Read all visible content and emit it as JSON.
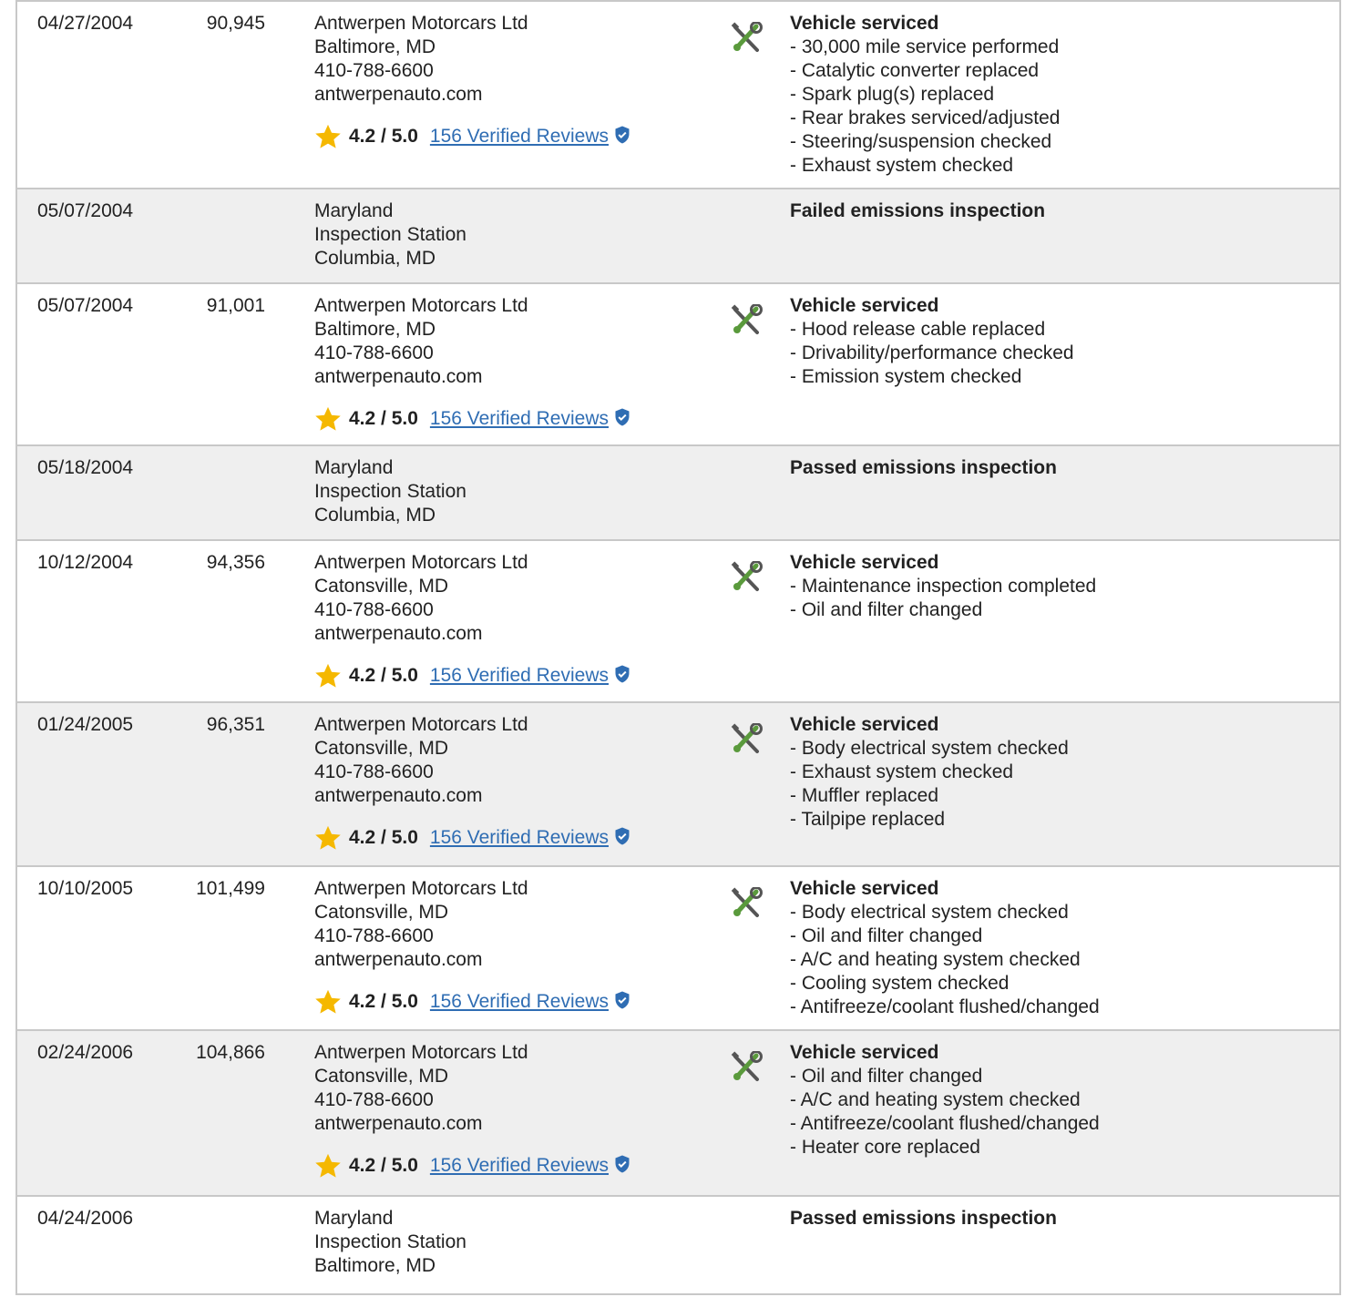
{
  "records": [
    {
      "date": "04/27/2004",
      "odometer": "90,945",
      "source": [
        "Antwerpen Motorcars Ltd",
        "Baltimore, MD",
        "410-788-6600",
        "antwerpenauto.com"
      ],
      "rating": "4.2 / 5.0",
      "reviews": "156 Verified Reviews",
      "service_icon": "wrench-screwdriver-icon",
      "heading": "Vehicle serviced",
      "items": [
        "- 30,000 mile service performed",
        "- Catalytic converter replaced",
        "- Spark plug(s) replaced",
        "- Rear brakes serviced/adjusted",
        "- Steering/suspension checked",
        "- Exhaust system checked"
      ]
    },
    {
      "date": "05/07/2004",
      "odometer": "",
      "source": [
        "Maryland",
        "Inspection Station",
        "Columbia, MD"
      ],
      "rating": "",
      "reviews": "",
      "service_icon": "",
      "heading": "Failed emissions inspection",
      "items": []
    },
    {
      "date": "05/07/2004",
      "odometer": "91,001",
      "source": [
        "Antwerpen Motorcars Ltd",
        "Baltimore, MD",
        "410-788-6600",
        "antwerpenauto.com"
      ],
      "rating": "4.2 / 5.0",
      "reviews": "156 Verified Reviews",
      "service_icon": "wrench-screwdriver-icon",
      "heading": "Vehicle serviced",
      "items": [
        "- Hood release cable replaced",
        "- Drivability/performance checked",
        "- Emission system checked"
      ]
    },
    {
      "date": "05/18/2004",
      "odometer": "",
      "source": [
        "Maryland",
        "Inspection Station",
        "Columbia, MD"
      ],
      "rating": "",
      "reviews": "",
      "service_icon": "",
      "heading": "Passed emissions inspection",
      "items": []
    },
    {
      "date": "10/12/2004",
      "odometer": "94,356",
      "source": [
        "Antwerpen Motorcars Ltd",
        "Catonsville, MD",
        "410-788-6600",
        "antwerpenauto.com"
      ],
      "rating": "4.2 / 5.0",
      "reviews": "156 Verified Reviews",
      "service_icon": "wrench-screwdriver-icon",
      "heading": "Vehicle serviced",
      "items": [
        "- Maintenance inspection completed",
        "- Oil and filter changed"
      ]
    },
    {
      "date": "01/24/2005",
      "odometer": "96,351",
      "source": [
        "Antwerpen Motorcars Ltd",
        "Catonsville, MD",
        "410-788-6600",
        "antwerpenauto.com"
      ],
      "rating": "4.2 / 5.0",
      "reviews": "156 Verified Reviews",
      "service_icon": "wrench-screwdriver-icon",
      "heading": "Vehicle serviced",
      "items": [
        "- Body electrical system checked",
        "- Exhaust system checked",
        "- Muffler replaced",
        "- Tailpipe replaced"
      ]
    },
    {
      "date": "10/10/2005",
      "odometer": "101,499",
      "source": [
        "Antwerpen Motorcars Ltd",
        "Catonsville, MD",
        "410-788-6600",
        "antwerpenauto.com"
      ],
      "rating": "4.2 / 5.0",
      "reviews": "156 Verified Reviews",
      "service_icon": "wrench-screwdriver-icon",
      "heading": "Vehicle serviced",
      "items": [
        "- Body electrical system checked",
        "- Oil and filter changed",
        "- A/C and heating system checked",
        "- Cooling system checked",
        "- Antifreeze/coolant flushed/changed"
      ]
    },
    {
      "date": "02/24/2006",
      "odometer": "104,866",
      "source": [
        "Antwerpen Motorcars Ltd",
        "Catonsville, MD",
        "410-788-6600",
        "antwerpenauto.com"
      ],
      "rating": "4.2 / 5.0",
      "reviews": "156 Verified Reviews",
      "service_icon": "wrench-screwdriver-icon",
      "heading": "Vehicle serviced",
      "items": [
        "- Oil and filter changed",
        "- A/C and heating system checked",
        "- Antifreeze/coolant flushed/changed",
        "- Heater core replaced"
      ]
    },
    {
      "date": "04/24/2006",
      "odometer": "",
      "source": [
        "Maryland",
        "Inspection Station",
        "Baltimore, MD"
      ],
      "rating": "",
      "reviews": "",
      "service_icon": "",
      "heading": "Passed emissions inspection",
      "items": []
    }
  ],
  "colors": {
    "link": "#2f6db3",
    "star": "#f5b800",
    "row_alt": "#efefef",
    "border": "#c8c8c8",
    "wrench": "#5a9a3c"
  }
}
